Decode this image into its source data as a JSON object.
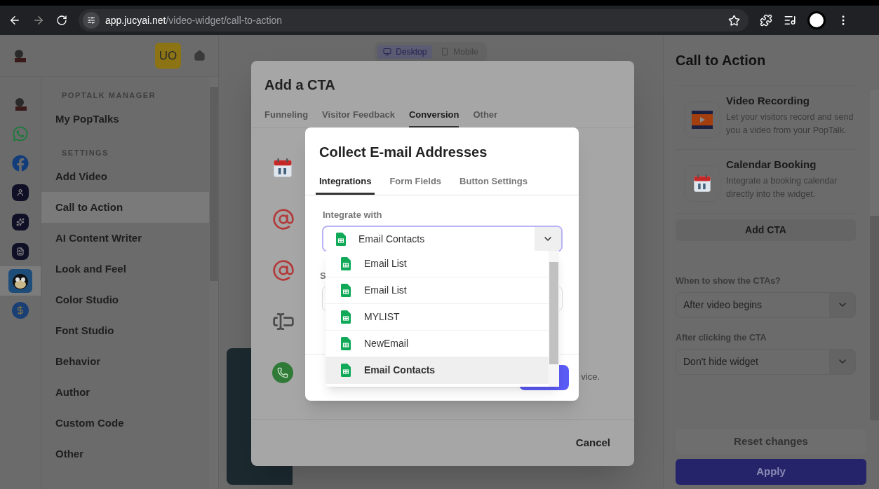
{
  "browser": {
    "url_host": "app.jucyai.net",
    "url_path": "/video-widget/call-to-action"
  },
  "header": {
    "avatar": "UO"
  },
  "rail": [
    {
      "kind": "logo",
      "selected": false
    },
    {
      "kind": "whatsapp",
      "selected": false
    },
    {
      "kind": "facebook",
      "selected": false
    },
    {
      "kind": "user",
      "selected": false
    },
    {
      "kind": "sparkle",
      "selected": false
    },
    {
      "kind": "document",
      "selected": false
    },
    {
      "kind": "cartoon",
      "selected": true
    },
    {
      "kind": "dollar",
      "selected": false
    }
  ],
  "sidebar": {
    "sections": [
      {
        "heading": "POPTALK MANAGER",
        "items": [
          {
            "label": "My PopTalks",
            "selected": false
          }
        ]
      },
      {
        "heading": "SETTINGS",
        "items": [
          {
            "label": "Add Video",
            "selected": false
          },
          {
            "label": "Call to Action",
            "selected": true
          },
          {
            "label": "AI Content Writer",
            "selected": false
          },
          {
            "label": "Look and Feel",
            "selected": false
          },
          {
            "label": "Color Studio",
            "selected": false
          },
          {
            "label": "Font Studio",
            "selected": false
          },
          {
            "label": "Behavior",
            "selected": false
          },
          {
            "label": "Author",
            "selected": false
          },
          {
            "label": "Custom Code",
            "selected": false
          },
          {
            "label": "Other",
            "selected": false
          }
        ]
      }
    ]
  },
  "view_toggle": [
    {
      "label": "Desktop",
      "selected": true
    },
    {
      "label": "Mobile",
      "selected": false
    }
  ],
  "cta_modal": {
    "title": "Add a CTA",
    "tabs": [
      {
        "label": "Funneling",
        "selected": false
      },
      {
        "label": "Visitor Feedback",
        "selected": false
      },
      {
        "label": "Conversion",
        "selected": true
      },
      {
        "label": "Other",
        "selected": false
      }
    ],
    "options": [
      {
        "kind": "calendar"
      },
      {
        "kind": "at"
      },
      {
        "kind": "at"
      },
      {
        "kind": "embed"
      },
      {
        "kind": "phone",
        "text": "vice."
      }
    ],
    "cancel": "Cancel"
  },
  "email_modal": {
    "title": "Collect E-mail Addresses",
    "tabs": [
      {
        "label": "Integrations",
        "selected": true
      },
      {
        "label": "Form Fields",
        "selected": false
      },
      {
        "label": "Button Settings",
        "selected": false
      }
    ],
    "integrate_label": "Integrate with",
    "integrate_value": "Email Contacts",
    "second_label": "S",
    "dropdown": [
      {
        "label": "Email List",
        "selected": false
      },
      {
        "label": "Email List",
        "selected": false
      },
      {
        "label": "MYLIST",
        "selected": false
      },
      {
        "label": "NewEmail",
        "selected": false
      },
      {
        "label": "Email Contacts",
        "selected": true
      }
    ]
  },
  "right_panel": {
    "title": "Call to Action",
    "cards": [
      {
        "kind": "video",
        "title": "Video Recording",
        "description": "Let your visitors record and send you a video from your PopTalk."
      },
      {
        "kind": "calendar",
        "title": "Calendar Booking",
        "description": "Integrate a booking calendar directly into the widget."
      }
    ],
    "add_button": "Add CTA",
    "fields": [
      {
        "label": "When to show the CTAs?",
        "value": "After video begins"
      },
      {
        "label": "After clicking the CTA",
        "value": "Don't hide widget"
      }
    ],
    "reset": "Reset changes",
    "apply": "Apply"
  }
}
